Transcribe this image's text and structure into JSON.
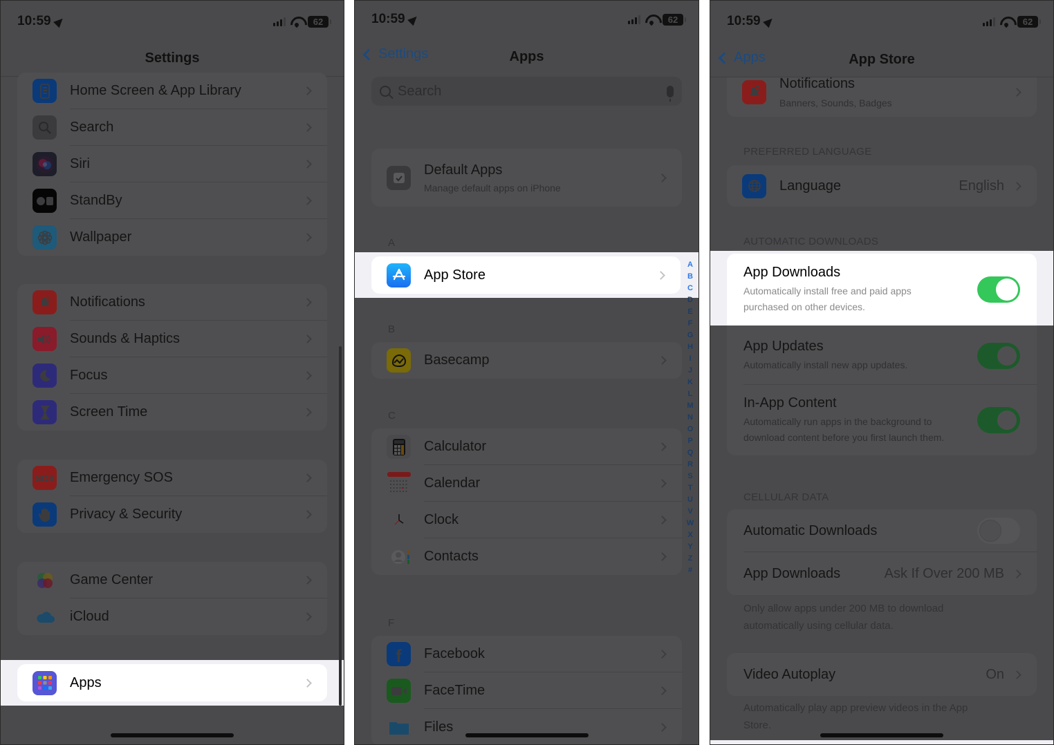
{
  "status_bar": {
    "time": "10:59",
    "battery": "62"
  },
  "panel1": {
    "title": "Settings",
    "groups": [
      [
        {
          "label": "Home Screen & App Library",
          "icon": "home-screen-icon",
          "color": "#0a3a7a"
        },
        {
          "label": "Search",
          "icon": "search-icon",
          "color": "#3b3b3d"
        },
        {
          "label": "Siri",
          "icon": "siri-icon",
          "color": "#1e1e2a"
        },
        {
          "label": "StandBy",
          "icon": "standby-icon",
          "color": "#060606"
        },
        {
          "label": "Wallpaper",
          "icon": "wallpaper-icon",
          "color": "#1e5a7a"
        }
      ],
      [
        {
          "label": "Notifications",
          "icon": "notifications-icon",
          "color": "#8a1d1b"
        },
        {
          "label": "Sounds & Haptics",
          "icon": "sounds-icon",
          "color": "#8a1b2a"
        },
        {
          "label": "Focus",
          "icon": "focus-moon-icon",
          "color": "#2e2a7a"
        },
        {
          "label": "Screen Time",
          "icon": "screen-time-hourglass-icon",
          "color": "#2e2a7a"
        }
      ],
      [
        {
          "label": "Emergency SOS",
          "icon": "sos-icon",
          "color": "#8a1d1b",
          "glyph": "SOS"
        },
        {
          "label": "Privacy & Security",
          "icon": "privacy-hand-icon",
          "color": "#0a3a7a"
        }
      ],
      [
        {
          "label": "Game Center",
          "icon": "game-center-icon",
          "color": "#5a2a4a"
        },
        {
          "label": "iCloud",
          "icon": "icloud-icon",
          "color": "#1c4a6a"
        }
      ]
    ],
    "highlight": {
      "label": "Apps",
      "icon": "apps-grid-icon",
      "color": "#5656d6"
    }
  },
  "panel2": {
    "back_label": "Settings",
    "title": "Apps",
    "search_placeholder": "Search",
    "default_apps": {
      "title": "Default Apps",
      "subtitle": "Manage default apps on iPhone"
    },
    "sections": [
      {
        "letter": "A",
        "items": [
          {
            "label": "App Store",
            "icon": "app-store-icon",
            "color": "#1a8cf5"
          }
        ]
      },
      {
        "letter": "B",
        "items": [
          {
            "label": "Basecamp",
            "icon": "basecamp-icon",
            "color": "#7a6a08"
          }
        ]
      },
      {
        "letter": "C",
        "items": [
          {
            "label": "Calculator",
            "icon": "calculator-icon",
            "color": "#4a4a4c"
          },
          {
            "label": "Calendar",
            "icon": "calendar-icon",
            "color": "#4f4f51"
          },
          {
            "label": "Clock",
            "icon": "clock-icon",
            "color": "#0d0d0d"
          },
          {
            "label": "Contacts",
            "icon": "contacts-icon",
            "color": "#5a5a5c"
          }
        ]
      },
      {
        "letter": "F",
        "items": [
          {
            "label": "Facebook",
            "icon": "facebook-icon",
            "color": "#0a3a7a"
          },
          {
            "label": "FaceTime",
            "icon": "facetime-icon",
            "color": "#1a5a1e"
          },
          {
            "label": "Files",
            "icon": "files-folder-icon",
            "color": "#1a4a6a"
          }
        ]
      }
    ],
    "index_letters": [
      "A",
      "B",
      "C",
      "D",
      "E",
      "F",
      "G",
      "H",
      "I",
      "J",
      "K",
      "L",
      "M",
      "N",
      "O",
      "P",
      "Q",
      "R",
      "S",
      "T",
      "U",
      "V",
      "W",
      "X",
      "Y",
      "Z",
      "#"
    ]
  },
  "panel3": {
    "back_label": "Apps",
    "title": "App Store",
    "notifications": {
      "title": "Notifications",
      "subtitle": "Banners, Sounds, Badges"
    },
    "preferred_language_header": "PREFERRED LANGUAGE",
    "language": {
      "label": "Language",
      "value": "English"
    },
    "automatic_downloads_header": "AUTOMATIC DOWNLOADS",
    "app_downloads": {
      "title": "App Downloads",
      "subtitle": "Automatically install free and paid apps purchased on other devices.",
      "on": true
    },
    "app_updates": {
      "title": "App Updates",
      "subtitle": "Automatically install new app updates.",
      "on": true
    },
    "in_app_content": {
      "title": "In-App Content",
      "subtitle": "Automatically run apps in the background to download content before you first launch them.",
      "on": true
    },
    "cellular_header": "CELLULAR DATA",
    "cellular_auto": {
      "title": "Automatic Downloads",
      "on": false
    },
    "cellular_app_downloads": {
      "title": "App Downloads",
      "value": "Ask If Over 200 MB"
    },
    "cellular_footer": "Only allow apps under 200 MB to download automatically using cellular data.",
    "video_autoplay": {
      "title": "Video Autoplay",
      "value": "On"
    },
    "video_footer": "Automatically play app preview videos in the App Store.",
    "toggle_on_color": "#34c759"
  }
}
